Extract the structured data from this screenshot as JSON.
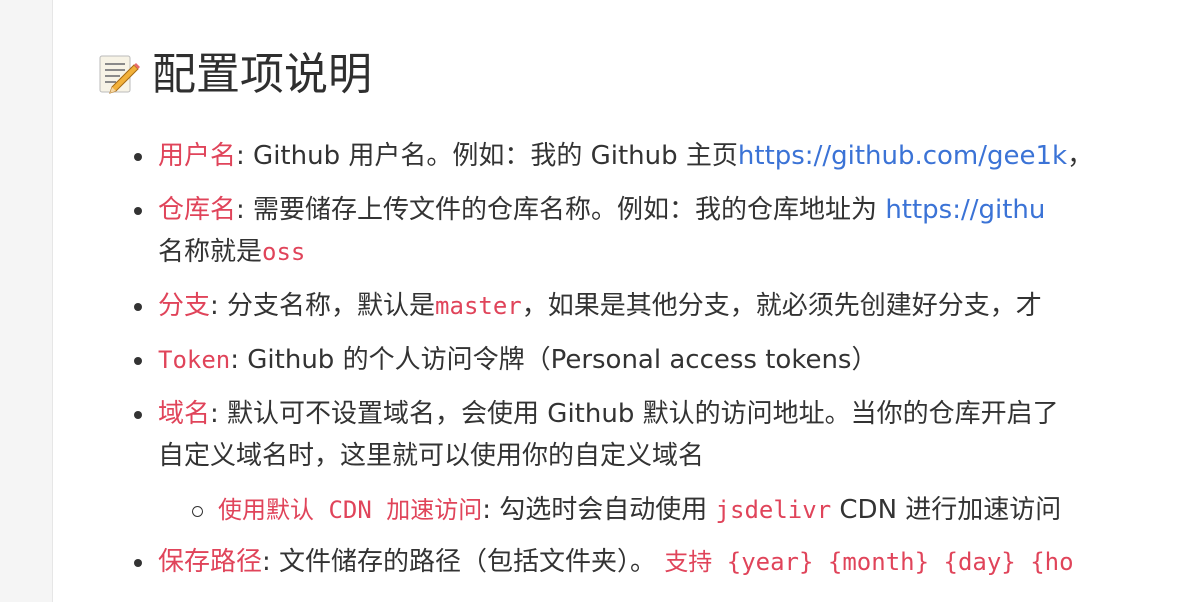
{
  "heading": {
    "icon": "memo-icon",
    "title": "配置项说明"
  },
  "items": [
    {
      "term": "用户名",
      "desc": ": Github 用户名。例如：我的 Github 主页",
      "link": "https://github.com/gee1k",
      "tail": "，"
    },
    {
      "term": "仓库名",
      "desc": ": 需要储存上传文件的仓库名称。例如：我的仓库地址为 ",
      "link": "https://githu",
      "line2_prefix": "名称就是",
      "line2_code": "oss"
    },
    {
      "term": "分支",
      "desc_a": ": 分支名称，默认是",
      "code": "master",
      "desc_b": "，如果是其他分支，就必须先创建好分支，才"
    },
    {
      "term_code": "Token",
      "desc": ": Github 的个人访问令牌（Personal access tokens）"
    },
    {
      "term": "域名",
      "desc": ": 默认可不设置域名，会使用 Github 默认的访问地址。当你的仓库开启了",
      "line2": "自定义域名时，这里就可以使用你的自定义域名",
      "sub": {
        "term": "使用默认 CDN 加速访问",
        "desc_a": ": 勾选时会自动使用 ",
        "code": "jsdelivr",
        "desc_b": " CDN 进行加速访问"
      }
    },
    {
      "term": "保存路径",
      "desc": ": 文件储存的路径（包括文件夹）。 ",
      "code": "支持 {year} {month} {day} {ho"
    }
  ]
}
